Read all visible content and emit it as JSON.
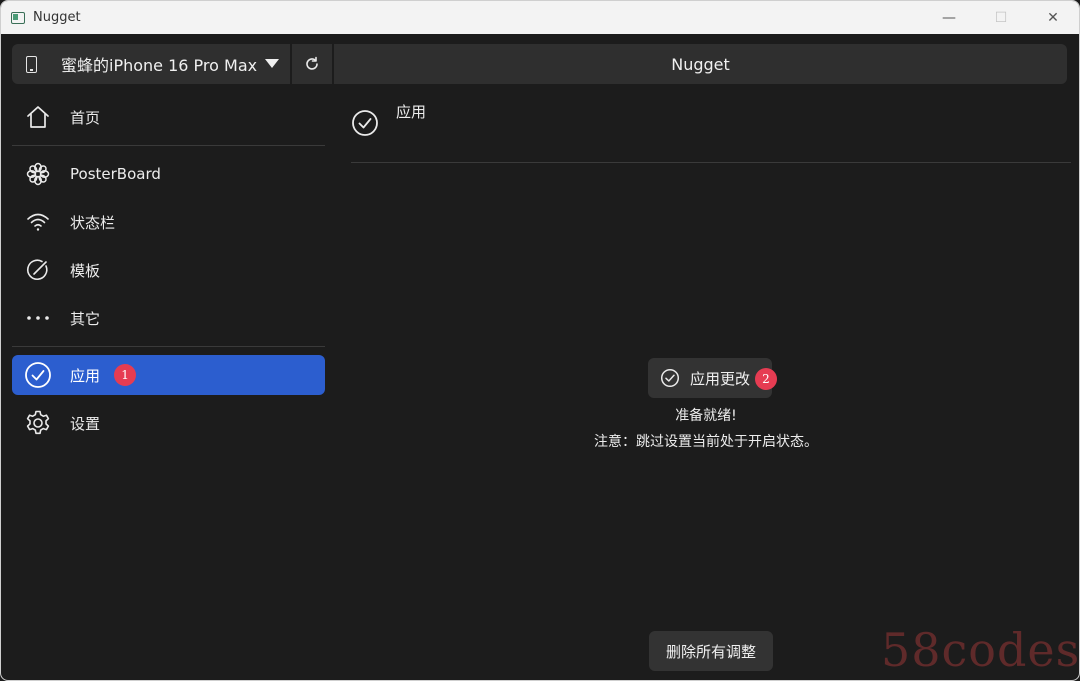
{
  "window": {
    "title": "Nugget",
    "minimize": "—",
    "maximize": "☐",
    "close": "✕"
  },
  "device_bar": {
    "device_name": "蜜蜂的iPhone 16 Pro Max",
    "header_title": "Nugget"
  },
  "sidebar": {
    "items": [
      {
        "label": "首页",
        "icon": "home-icon"
      },
      {
        "label": "PosterBoard",
        "icon": "flower-icon"
      },
      {
        "label": "状态栏",
        "icon": "wifi-icon"
      },
      {
        "label": "模板",
        "icon": "template-icon"
      },
      {
        "label": "其它",
        "icon": "more-icon"
      },
      {
        "label": "应用",
        "icon": "check-circle-icon",
        "badge": "1",
        "active": true
      },
      {
        "label": "设置",
        "icon": "gear-icon"
      }
    ]
  },
  "main": {
    "title": "应用",
    "apply_button": {
      "label": "应用更改",
      "badge": "2"
    },
    "status": "准备就绪!",
    "note": "注意：跳过设置当前处于开启状态。",
    "remove_button": "删除所有调整"
  },
  "watermark": "58codes",
  "colors": {
    "accent": "#2c5ecf",
    "badge": "#e63c52",
    "background": "#1c1c1c",
    "panel": "#2f2f2f"
  }
}
